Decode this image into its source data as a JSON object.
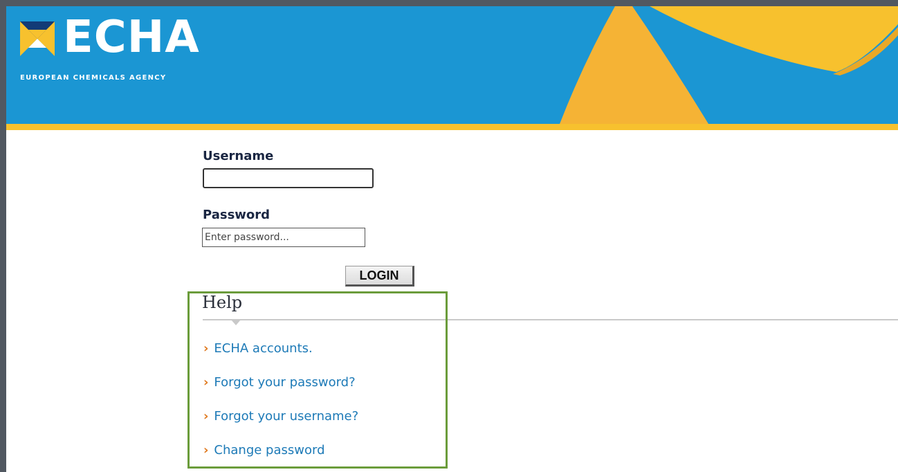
{
  "header": {
    "logo_text": "ECHA",
    "logo_subtitle": "EUROPEAN CHEMICALS AGENCY",
    "colors": {
      "banner": "#1b96d3",
      "stripe": "#f7c12e",
      "accent": "#f5b335"
    }
  },
  "login_form": {
    "username_label": "Username",
    "username_value": "",
    "password_label": "Password",
    "password_placeholder": "Enter password...",
    "login_button": "LOGIN"
  },
  "help": {
    "title": "Help",
    "links": [
      {
        "label": "ECHA accounts.",
        "icon": "chevron-right-icon"
      },
      {
        "label": "Forgot your password?",
        "icon": "chevron-right-icon"
      },
      {
        "label": "Forgot your username?",
        "icon": "chevron-right-icon"
      },
      {
        "label": "Change password",
        "icon": "chevron-right-icon"
      }
    ],
    "highlight_color": "#6b9c3b"
  }
}
